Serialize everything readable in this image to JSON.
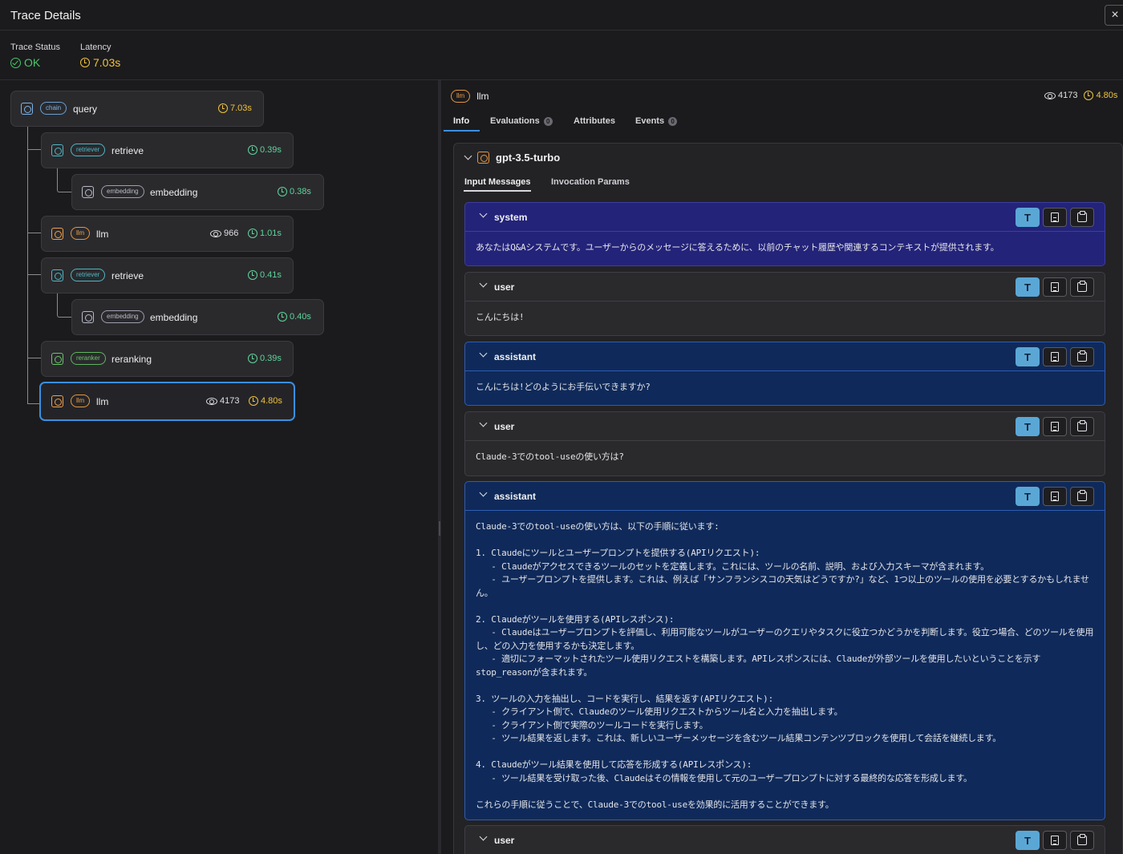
{
  "header": {
    "title": "Trace Details",
    "close_label": "×"
  },
  "status": {
    "trace_status_label": "Trace Status",
    "trace_status_value": "OK",
    "latency_label": "Latency",
    "latency_value": "7.03s"
  },
  "tree": [
    {
      "kind": "chain",
      "name": "query",
      "tokens": "",
      "latency": "7.03s"
    },
    {
      "kind": "retriever",
      "name": "retrieve",
      "tokens": "",
      "latency": "0.39s"
    },
    {
      "kind": "embedding",
      "name": "embedding",
      "tokens": "",
      "latency": "0.38s"
    },
    {
      "kind": "llm",
      "name": "llm",
      "tokens": "966",
      "latency": "1.01s"
    },
    {
      "kind": "retriever",
      "name": "retrieve",
      "tokens": "",
      "latency": "0.41s"
    },
    {
      "kind": "embedding",
      "name": "embedding",
      "tokens": "",
      "latency": "0.40s"
    },
    {
      "kind": "reranker",
      "name": "reranking",
      "tokens": "",
      "latency": "0.39s"
    },
    {
      "kind": "llm",
      "name": "llm",
      "tokens": "4173",
      "latency": "4.80s"
    }
  ],
  "span": {
    "kind": "llm",
    "name": "llm",
    "tokens": "4173",
    "latency": "4.80s",
    "tabs": [
      {
        "label": "Info",
        "count": ""
      },
      {
        "label": "Evaluations",
        "count": "0"
      },
      {
        "label": "Attributes",
        "count": ""
      },
      {
        "label": "Events",
        "count": "0"
      }
    ],
    "model": "gpt-3.5-turbo",
    "sub_tabs": [
      "Input Messages",
      "Invocation Params"
    ],
    "text_button": "T",
    "messages": [
      {
        "role": "system",
        "content": "あなたはQ&Aシステムです。ユーザーからのメッセージに答えるために、以前のチャット履歴や関連するコンテキストが提供されます。"
      },
      {
        "role": "user",
        "content": "こんにちは!"
      },
      {
        "role": "assistant",
        "content": "こんにちは!どのようにお手伝いできますか?"
      },
      {
        "role": "user",
        "content": "Claude-3でのtool-useの使い方は?"
      },
      {
        "role": "assistant",
        "content": "Claude-3でのtool-useの使い方は、以下の手順に従います:\n\n1. Claudeにツールとユーザープロンプトを提供する(APIリクエスト):\n   - Claudeがアクセスできるツールのセットを定義します。これには、ツールの名前、説明、および入力スキーマが含まれます。\n   - ユーザープロンプトを提供します。これは、例えば「サンフランシスコの天気はどうですか?」など、1つ以上のツールの使用を必要とするかもしれません。\n\n2. Claudeがツールを使用する(APIレスポンス):\n   - Claudeはユーザープロンプトを評価し、利用可能なツールがユーザーのクエリやタスクに役立つかどうかを判断します。役立つ場合、どのツールを使用し、どの入力を使用するかも決定します。\n   - 適切にフォーマットされたツール使用リクエストを構築します。APIレスポンスには、Claudeが外部ツールを使用したいということを示すstop_reasonが含まれます。\n\n3. ツールの入力を抽出し、コードを実行し、結果を返す(APIリクエスト):\n   - クライアント側で、Claudeのツール使用リクエストからツール名と入力を抽出します。\n   - クライアント側で実際のツールコードを実行します。\n   - ツール結果を返します。これは、新しいユーザーメッセージを含むツール結果コンテンツブロックを使用して会話を継続します。\n\n4. Claudeがツール結果を使用して応答を形成する(APIレスポンス):\n   - ツール結果を受け取った後、Claudeはその情報を使用して元のユーザープロンプトに対する最終的な応答を形成します。\n\nこれらの手順に従うことで、Claude-3でのtool-useを効果的に活用することができます。"
      },
      {
        "role": "user",
        "content": ""
      }
    ]
  },
  "colors": {
    "accent": "#3b8fe0",
    "ok": "#46c766",
    "latency": "#f0c23a",
    "system_bg": "#23237a",
    "assistant_bg": "#0f2a5a"
  }
}
